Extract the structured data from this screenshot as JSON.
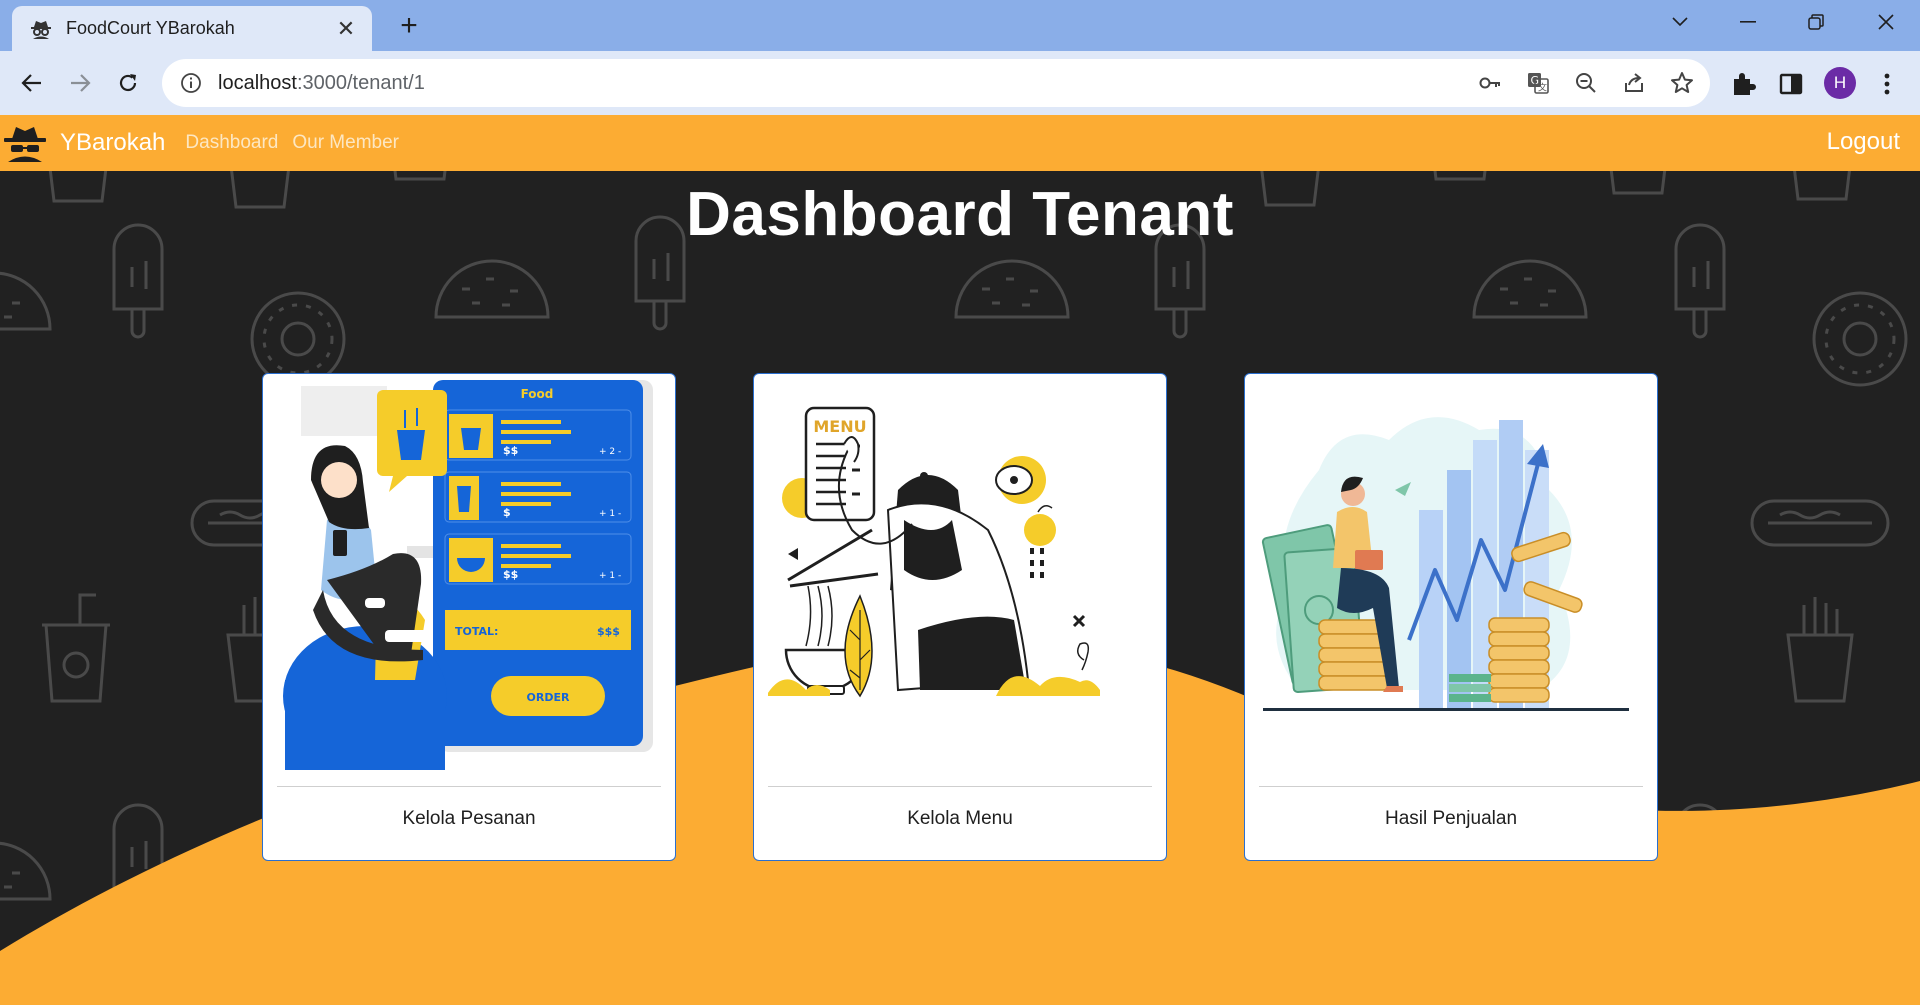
{
  "browser": {
    "tab_title": "FoodCourt YBarokah",
    "url_host": "localhost",
    "url_path": ":3000/tenant/1",
    "profile_initial": "H"
  },
  "navbar": {
    "brand": "YBarokah",
    "links": [
      "Dashboard",
      "Our Member"
    ],
    "logout": "Logout"
  },
  "page": {
    "title": "Dashboard Tenant"
  },
  "cards": [
    {
      "label": "Kelola Pesanan",
      "illustration": "food-order-illustration"
    },
    {
      "label": "Kelola Menu",
      "illustration": "menu-illustration"
    },
    {
      "label": "Hasil Penjualan",
      "illustration": "sales-growth-illustration"
    }
  ],
  "illustration_text": {
    "food_app_header": "Food",
    "price_1": "$$",
    "price_2": "$",
    "price_3": "$$",
    "qty_1": "+ 2 -",
    "qty_2": "+ 1 -",
    "qty_3": "+ 1 -",
    "total_label": "TOTAL:",
    "total_value": "$$$",
    "order_button": "ORDER",
    "menu_board": "MENU"
  },
  "colors": {
    "accent": "#fcac33",
    "background": "#212121",
    "card_border": "#2a6fd0",
    "illustration_yellow": "#f5cc2a",
    "illustration_blue": "#1565d8"
  }
}
